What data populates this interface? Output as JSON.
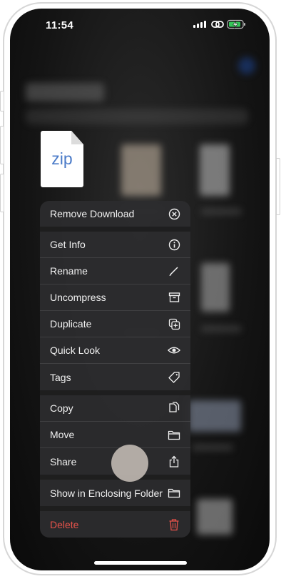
{
  "status_bar": {
    "time": "11:54"
  },
  "file": {
    "icon_label": "zip"
  },
  "menu": {
    "items": [
      {
        "label": "Remove Download",
        "icon": "remove-circle-icon"
      },
      {
        "label": "Get Info",
        "icon": "info-icon"
      },
      {
        "label": "Rename",
        "icon": "pencil-icon"
      },
      {
        "label": "Uncompress",
        "icon": "archive-box-icon"
      },
      {
        "label": "Duplicate",
        "icon": "duplicate-icon"
      },
      {
        "label": "Quick Look",
        "icon": "eye-icon"
      },
      {
        "label": "Tags",
        "icon": "tag-icon"
      },
      {
        "label": "Copy",
        "icon": "copy-icon"
      },
      {
        "label": "Move",
        "icon": "folder-icon"
      },
      {
        "label": "Share",
        "icon": "share-icon"
      },
      {
        "label": "Show in Enclosing Folder",
        "icon": "folder-icon"
      },
      {
        "label": "Delete",
        "icon": "trash-icon"
      }
    ]
  },
  "colors": {
    "destructive": "#e5524a",
    "zip_label": "#4b7bc8"
  }
}
